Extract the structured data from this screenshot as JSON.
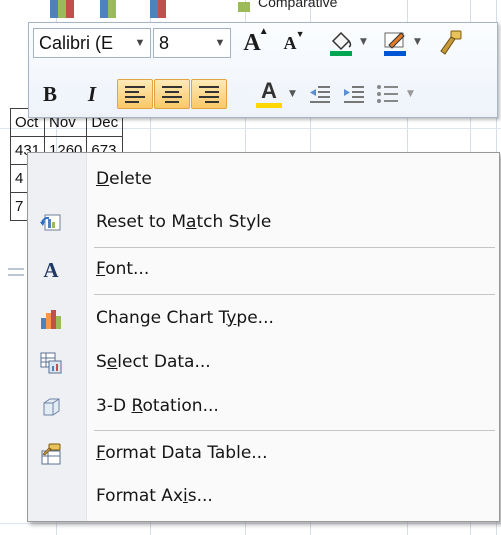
{
  "sheet": {
    "legend_label": "Comparative",
    "table": {
      "headers": [
        "Oct",
        "Nov",
        "Dec"
      ],
      "row1": [
        "431",
        "1260",
        "673"
      ],
      "row2_first": "4",
      "row3_first": "7"
    }
  },
  "mini_toolbar": {
    "font_name": "Calibri (E",
    "font_size": "8",
    "bold_label": "B",
    "italic_label": "I",
    "grow_font_label": "A",
    "shrink_font_label": "A",
    "font_color_label": "A",
    "colors": {
      "fill": "#00a651",
      "font": "#ffd700",
      "line": "#0055d4",
      "active_bg": "#fbc967"
    }
  },
  "context_menu": {
    "items": [
      {
        "label_pre": "",
        "accel": "D",
        "label_post": "elete",
        "icon": "none"
      },
      {
        "label_pre": "Reset to M",
        "accel": "a",
        "label_post": "tch Style",
        "icon": "reset-style-icon"
      },
      {
        "label_pre": "",
        "accel": "F",
        "label_post": "ont...",
        "icon": "font-icon"
      },
      {
        "label_pre": "Change Chart T",
        "accel": "y",
        "label_post": "pe...",
        "icon": "chart-type-icon"
      },
      {
        "label_pre": "S",
        "accel": "e",
        "label_post": "lect Data...",
        "icon": "select-data-icon"
      },
      {
        "label_pre": "3-D ",
        "accel": "R",
        "label_post": "otation...",
        "icon": "cube-icon"
      },
      {
        "label_pre": "",
        "accel": "F",
        "label_post": "ormat Data Table...",
        "icon": "format-icon"
      },
      {
        "label_pre": "Format Ax",
        "accel": "i",
        "label_post": "s...",
        "icon": "none"
      }
    ]
  }
}
